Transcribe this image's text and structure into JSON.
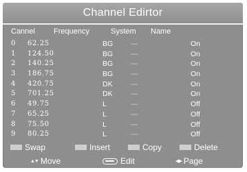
{
  "title": "Channel Edirtor",
  "columns": [
    "Cannel",
    "Frequency",
    "System",
    "Name"
  ],
  "channels": [
    {
      "num": "0",
      "freq": "62.25",
      "system": "BG",
      "name": "----",
      "state": "On"
    },
    {
      "num": "1",
      "freq": "124.50",
      "system": "BG",
      "name": "----",
      "state": "On"
    },
    {
      "num": "2",
      "freq": "140.25",
      "system": "BG",
      "name": "----",
      "state": "On"
    },
    {
      "num": "3",
      "freq": "186.75",
      "system": "BG",
      "name": "----",
      "state": "On"
    },
    {
      "num": "4",
      "freq": "420.75",
      "system": "DK",
      "name": "----",
      "state": "On"
    },
    {
      "num": "5",
      "freq": "701.25",
      "system": "DK",
      "name": "----",
      "state": "On"
    },
    {
      "num": "6",
      "freq": "49.75",
      "system": "L",
      "name": "----",
      "state": "Off"
    },
    {
      "num": "7",
      "freq": "65.25",
      "system": "L",
      "name": "----",
      "state": "Off"
    },
    {
      "num": "8",
      "freq": "75.50",
      "system": "L",
      "name": "----",
      "state": "Off"
    },
    {
      "num": "9",
      "freq": "80.25",
      "system": "L",
      "name": "----",
      "state": "Off"
    }
  ],
  "legend": {
    "swap": "Swap",
    "insert": "Insert",
    "copy": "Copy",
    "delete": "Delete"
  },
  "nav": {
    "move": "Move",
    "edit": "Edit",
    "page": "Page",
    "move_arrows": "▲▼",
    "page_arrows": "◀▶"
  },
  "colors": {
    "background": "#8e8e8e",
    "swatch": "#cfcfcf",
    "text": "#ffffff"
  }
}
